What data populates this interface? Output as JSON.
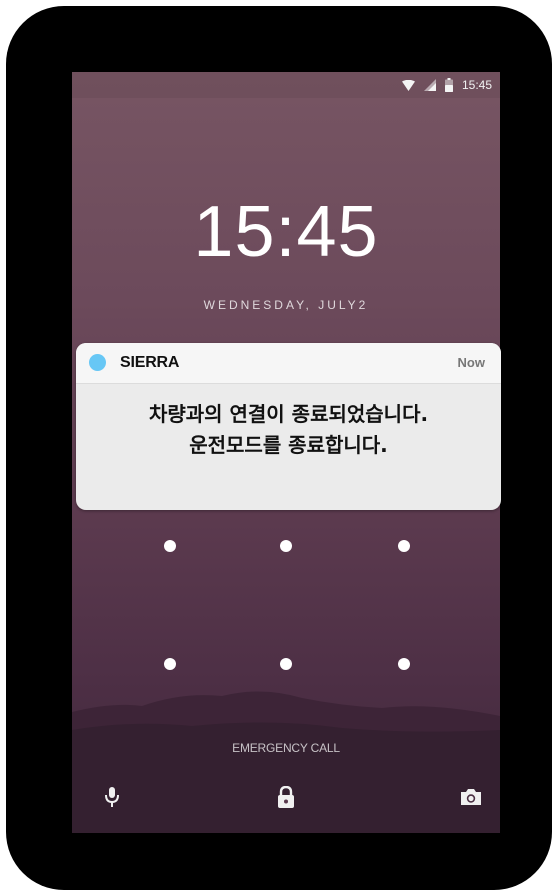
{
  "status_bar": {
    "icons": [
      "wifi-icon",
      "cellular-signal-icon",
      "battery-icon"
    ],
    "time": "15:45"
  },
  "lock_screen": {
    "clock": "15:45",
    "date": "WEDNESDAY, JULY2",
    "pattern_dots": 6,
    "emergency_call": "EMERGENCY CALL",
    "bottom_icons": [
      "microphone-icon",
      "lock-icon",
      "camera-icon"
    ]
  },
  "notification": {
    "app_name": "SIERRA",
    "time": "Now",
    "line1": "차량과의 연결이 종료되었습니다.",
    "line2": "운전모드를 종료합니다.",
    "app_icon_color": "#67c7f5"
  },
  "colors": {
    "bezel": "#000000",
    "wallpaper_top": "#775563",
    "wallpaper_bottom": "#3e2639"
  }
}
